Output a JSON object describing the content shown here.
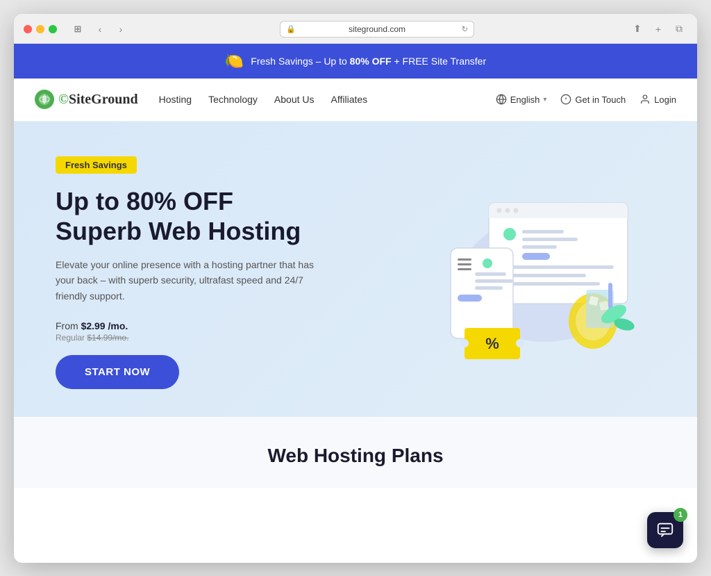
{
  "browser": {
    "url": "siteground.com",
    "traffic_lights": [
      "red",
      "yellow",
      "green"
    ]
  },
  "promo_banner": {
    "text_pre": "Fresh Savings – Up to ",
    "text_bold": "80% OFF",
    "text_post": " + FREE Site Transfer",
    "lemon_icon": "🍋"
  },
  "nav": {
    "logo_text": "SiteGround",
    "links": [
      "Hosting",
      "Technology",
      "About Us",
      "Affiliates"
    ],
    "right_items": {
      "language": "English",
      "contact": "Get in Touch",
      "login": "Login"
    }
  },
  "hero": {
    "badge": "Fresh Savings",
    "title_line1": "Up to 80% OFF",
    "title_line2": "Superb Web Hosting",
    "description": "Elevate your online presence with a hosting partner that has your back – with superb security, ultrafast speed and 24/7 friendly support.",
    "price_from_label": "From ",
    "price_from_value": "$2.99 /mo.",
    "price_regular_label": "Regular ",
    "price_regular_value": "$14.99/mo.",
    "cta_button": "START NOW"
  },
  "plans_section": {
    "title": "Web Hosting Plans"
  },
  "chat_widget": {
    "badge_count": "1"
  }
}
